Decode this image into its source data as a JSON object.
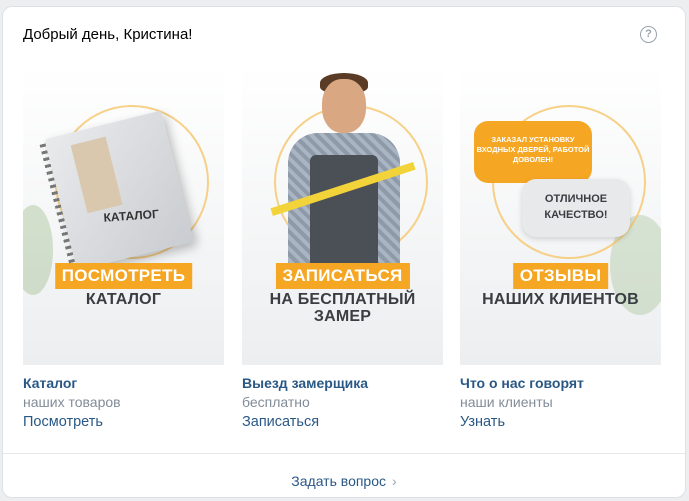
{
  "header": {
    "greeting": "Добрый день, Кристина!",
    "help_icon": "?"
  },
  "tiles": [
    {
      "badge": "ПОСМОТРЕТЬ",
      "subtitle": "КАТАЛОГ",
      "art_text": "КАТАЛОГ",
      "title": "Каталог",
      "description": "наших товаров",
      "action": "Посмотреть"
    },
    {
      "badge": "ЗАПИСАТЬСЯ",
      "subtitle": "НА БЕСПЛАТНЫЙ ЗАМЕР",
      "title": "Выезд замерщика",
      "description": "бесплатно",
      "action": "Записаться"
    },
    {
      "badge": "ОТЗЫВЫ",
      "subtitle": "НАШИХ КЛИЕНТОВ",
      "bubble_top": "ЗАКАЗАЛ УСТАНОВКУ ВХОДНЫХ ДВЕРЕЙ, РАБОТОЙ ДОВОЛЕН!",
      "bubble_bottom": "ОТЛИЧНОЕ КАЧЕСТВО!",
      "title": "Что о нас говорят",
      "description": "наши клиенты",
      "action": "Узнать"
    }
  ],
  "footer": {
    "ask_label": "Задать вопрос",
    "chevron": "›"
  },
  "colors": {
    "accent": "#f5a623",
    "link": "#2a5885",
    "muted": "#818c99"
  }
}
